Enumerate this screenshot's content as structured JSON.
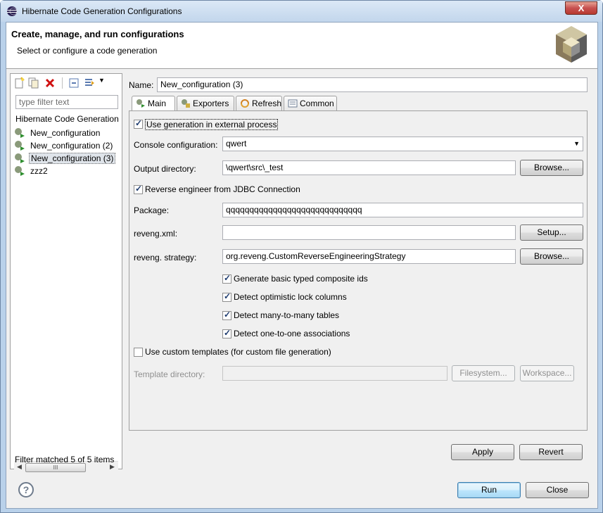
{
  "window": {
    "title": "Hibernate Code Generation Configurations",
    "close_label": "X"
  },
  "header": {
    "title": "Create, manage, and run configurations",
    "subtitle": "Select or configure a code generation"
  },
  "left": {
    "toolbar_icons": [
      "new-config-icon",
      "duplicate-icon",
      "delete-icon",
      "collapse-all-icon",
      "filter-icon",
      "dropdown-arrow-icon"
    ],
    "filter_placeholder": "type filter text",
    "tree_root": "Hibernate Code Generation",
    "items": [
      {
        "label": "New_configuration",
        "selected": false
      },
      {
        "label": "New_configuration (2)",
        "selected": false
      },
      {
        "label": "New_configuration (3)",
        "selected": true
      },
      {
        "label": "zzz2",
        "selected": false
      }
    ],
    "scroll_thumb": "III",
    "filter_status": "Filter matched 5 of 5 items"
  },
  "config": {
    "name_label": "Name:",
    "name_value": "New_configuration (3)",
    "tabs": [
      {
        "label": "Main",
        "active": true
      },
      {
        "label": "Exporters",
        "active": false
      },
      {
        "label": "Refresh",
        "active": false
      },
      {
        "label": "Common",
        "active": false
      }
    ],
    "use_external": {
      "label": "Use generation in external process",
      "checked": true
    },
    "console_label": "Console configuration:",
    "console_value": "qwert",
    "output_label": "Output directory:",
    "output_value": "\\qwert\\src\\_test",
    "browse_label": "Browse...",
    "reverse_engineer": {
      "label": "Reverse engineer from JDBC Connection",
      "checked": true
    },
    "package_label": "Package:",
    "package_value": "qqqqqqqqqqqqqqqqqqqqqqqqqqqqq",
    "reveng_xml_label": "reveng.xml:",
    "reveng_xml_value": "",
    "setup_label": "Setup...",
    "strategy_label": "reveng. strategy:",
    "strategy_value": "org.reveng.CustomReverseEngineeringStrategy",
    "browse2_label": "Browse...",
    "options": [
      {
        "label": "Generate basic typed composite ids",
        "checked": true
      },
      {
        "label": "Detect optimistic lock columns",
        "checked": true
      },
      {
        "label": "Detect many-to-many tables",
        "checked": true
      },
      {
        "label": "Detect one-to-one associations",
        "checked": true
      }
    ],
    "custom_templates": {
      "label": "Use custom templates (for custom file generation)",
      "checked": false
    },
    "template_dir_label": "Template directory:",
    "template_dir_value": "",
    "filesystem_label": "Filesystem...",
    "workspace_label": "Workspace..."
  },
  "buttons": {
    "apply": "Apply",
    "revert": "Revert",
    "run": "Run",
    "close": "Close",
    "help": "?"
  }
}
